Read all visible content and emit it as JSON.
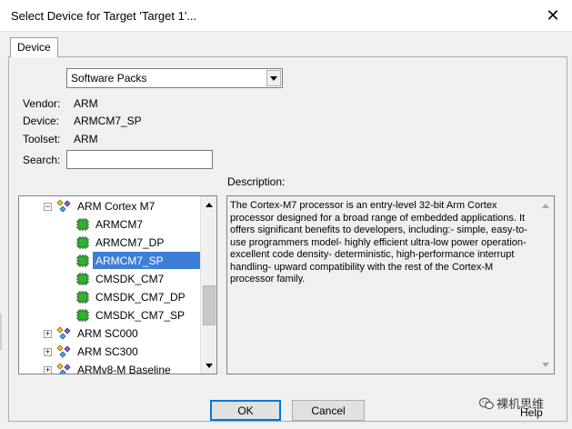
{
  "window": {
    "title": "Select Device for Target 'Target 1'..."
  },
  "tab": {
    "label": "Device"
  },
  "source_select": {
    "value": "Software Packs"
  },
  "info": {
    "vendor_label": "Vendor:",
    "vendor_value": "ARM",
    "device_label": "Device:",
    "device_value": "ARMCM7_SP",
    "toolset_label": "Toolset:",
    "toolset_value": "ARM",
    "search_label": "Search:",
    "search_value": ""
  },
  "description": {
    "label": "Description:",
    "text": "The Cortex-M7 processor is an entry-level 32-bit Arm Cortex processor designed for a broad range of embedded applications. It offers significant benefits to developers, including:- simple, easy-to-use programmers model- highly efficient ultra-low power operation- excellent code density- deterministic, high-performance interrupt handling- upward compatibility with the rest of the Cortex-M processor family."
  },
  "tree": {
    "items": [
      {
        "label": "ARM Cortex M7",
        "level": 0,
        "type": "family",
        "expander": "−"
      },
      {
        "label": "ARMCM7",
        "level": 1,
        "type": "device"
      },
      {
        "label": "ARMCM7_DP",
        "level": 1,
        "type": "device"
      },
      {
        "label": "ARMCM7_SP",
        "level": 1,
        "type": "device",
        "selected": true
      },
      {
        "label": "CMSDK_CM7",
        "level": 1,
        "type": "device"
      },
      {
        "label": "CMSDK_CM7_DP",
        "level": 1,
        "type": "device"
      },
      {
        "label": "CMSDK_CM7_SP",
        "level": 1,
        "type": "device"
      },
      {
        "label": "ARM SC000",
        "level": 0,
        "type": "family",
        "expander": "+"
      },
      {
        "label": "ARM SC300",
        "level": 0,
        "type": "family",
        "expander": "+"
      },
      {
        "label": "ARMv8-M Baseline",
        "level": 0,
        "type": "family",
        "expander": "+"
      }
    ]
  },
  "buttons": {
    "ok": "OK",
    "cancel": "Cancel",
    "help": "Help"
  },
  "watermark": {
    "text": "裸机思维"
  },
  "colors": {
    "selection": "#3d7ed7",
    "chip_green": "#2db52d",
    "accent": "#0078d7"
  }
}
